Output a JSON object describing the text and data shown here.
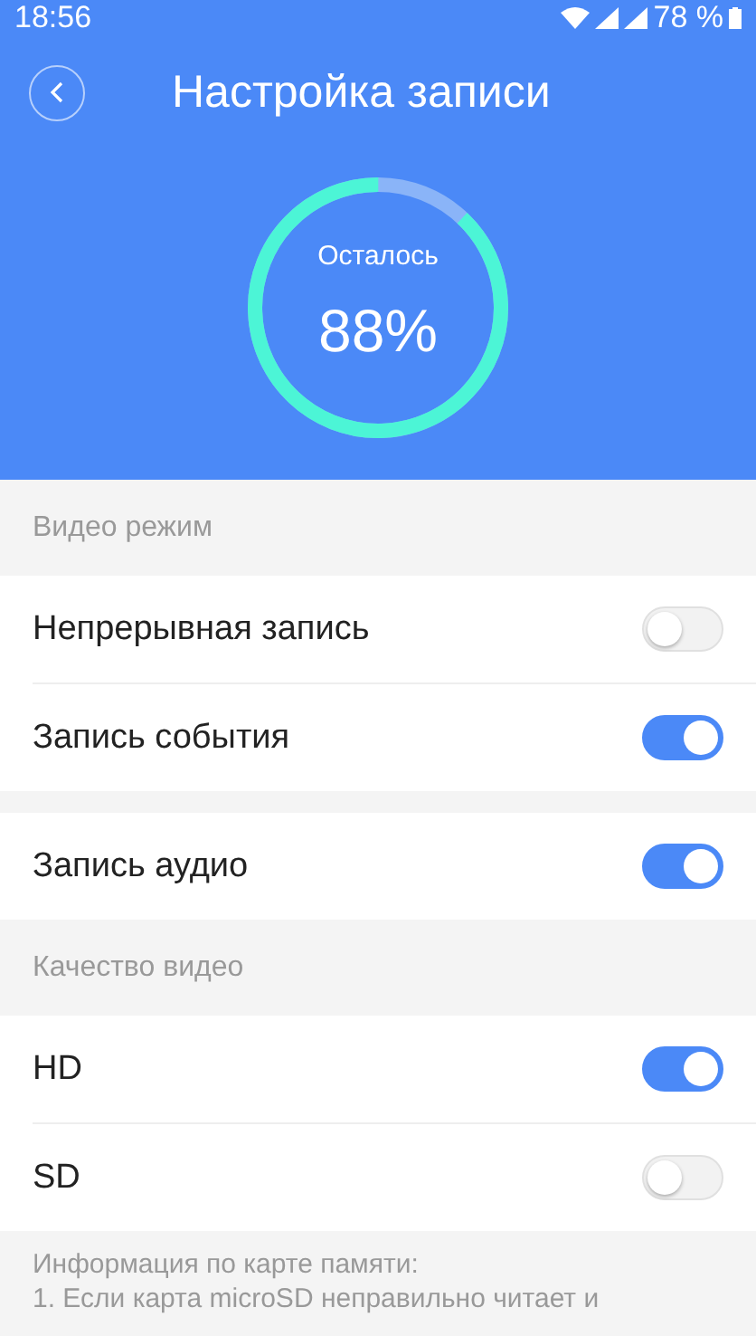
{
  "status_bar": {
    "time": "18:56",
    "battery": "78 %"
  },
  "header": {
    "title": "Настройка записи"
  },
  "storage": {
    "label": "Осталось",
    "value": "88%",
    "level": 0.88
  },
  "groups": [
    {
      "title": "Видео режим",
      "blocks": [
        [
          {
            "label": "Непрерывная запись",
            "on": false
          },
          {
            "label": "Запись события",
            "on": true
          }
        ],
        [
          {
            "label": "Запись аудио",
            "on": true
          }
        ]
      ]
    },
    {
      "title": "Качество видео",
      "blocks": [
        [
          {
            "label": "HD",
            "on": true
          },
          {
            "label": "SD",
            "on": false
          }
        ]
      ]
    }
  ],
  "info": {
    "title": "Информация по карте памяти:",
    "line": "1. Если карта microSD неправильно читает и"
  }
}
